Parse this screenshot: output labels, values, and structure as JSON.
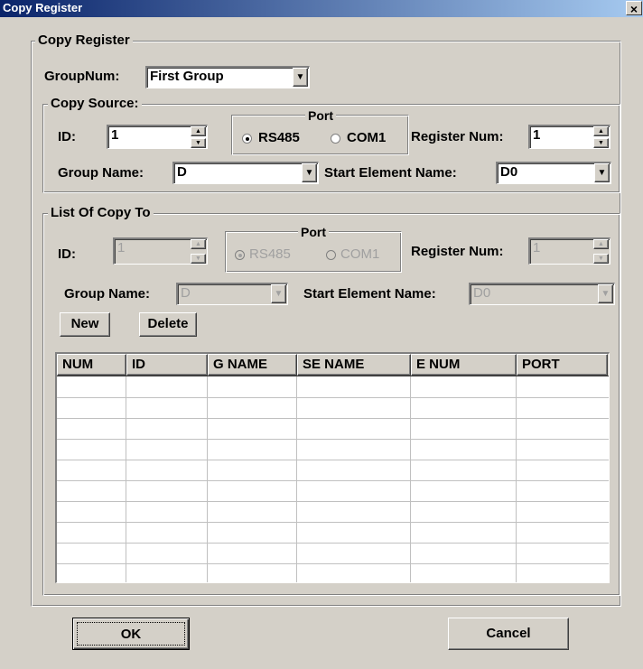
{
  "window": {
    "title": "Copy Register",
    "close_glyph": "×"
  },
  "main_group": {
    "label": "Copy Register"
  },
  "group_num": {
    "label": "GroupNum:",
    "value": "First Group"
  },
  "copy_source": {
    "label": "Copy Source:",
    "id_label": "ID:",
    "id_value": "1",
    "port_label": "Port",
    "port_options": [
      "RS485",
      "COM1"
    ],
    "port_selected": "RS485",
    "register_num_label": "Register Num:",
    "register_num_value": "1",
    "group_name_label": "Group Name:",
    "group_name_value": "D",
    "start_element_label": "Start Element Name:",
    "start_element_value": "D0"
  },
  "copy_to": {
    "label": "List Of Copy To",
    "id_label": "ID:",
    "id_value": "1",
    "port_label": "Port",
    "port_options": [
      "RS485",
      "COM1"
    ],
    "port_selected": "RS485",
    "register_num_label": "Register Num:",
    "register_num_value": "1",
    "group_name_label": "Group Name:",
    "group_name_value": "D",
    "start_element_label": "Start Element Name:",
    "start_element_value": "D0",
    "new_label": "New",
    "delete_label": "Delete",
    "table": {
      "columns": [
        "NUM",
        "ID",
        "G NAME",
        "SE NAME",
        "E NUM",
        "PORT"
      ],
      "rows": []
    }
  },
  "buttons": {
    "ok_label": "OK",
    "cancel_label": "Cancel"
  }
}
